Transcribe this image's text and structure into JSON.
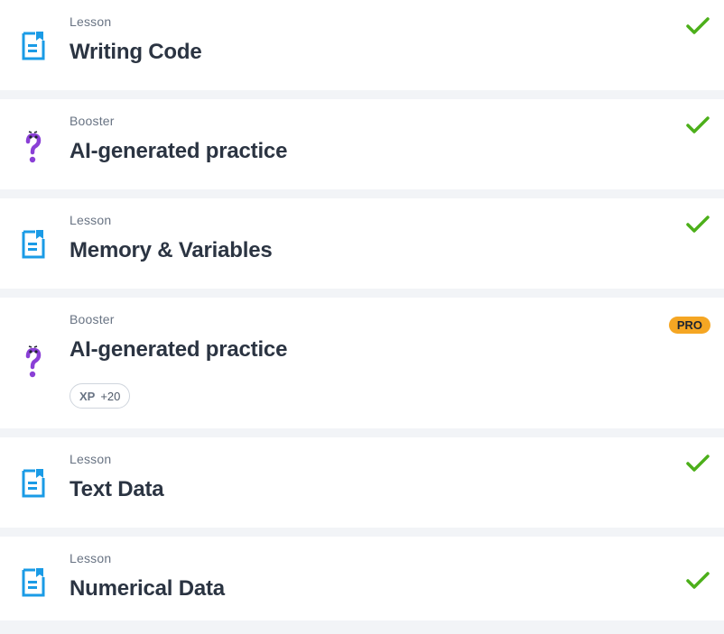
{
  "items": [
    {
      "kind": "Lesson",
      "title": "Writing Code",
      "icon": "lesson-doc-icon",
      "status": "completed"
    },
    {
      "kind": "Booster",
      "title": "AI-generated practice",
      "icon": "question-mark-icon",
      "status": "completed"
    },
    {
      "kind": "Lesson",
      "title": "Memory & Variables",
      "icon": "lesson-doc-icon",
      "status": "completed"
    },
    {
      "kind": "Booster",
      "title": "AI-generated practice",
      "icon": "question-mark-icon",
      "status": "pro",
      "badge": "PRO",
      "xp_label": "XP",
      "xp_value": "+20"
    },
    {
      "kind": "Lesson",
      "title": "Text Data",
      "icon": "lesson-doc-icon",
      "status": "completed"
    },
    {
      "kind": "Lesson",
      "title": "Numerical Data",
      "icon": "lesson-doc-icon",
      "status": "completed"
    }
  ],
  "colors": {
    "accent_blue": "#1a9be6",
    "check_green": "#4caf1a",
    "booster_purple": "#8a3fd6",
    "pro_orange": "#f5a623"
  }
}
